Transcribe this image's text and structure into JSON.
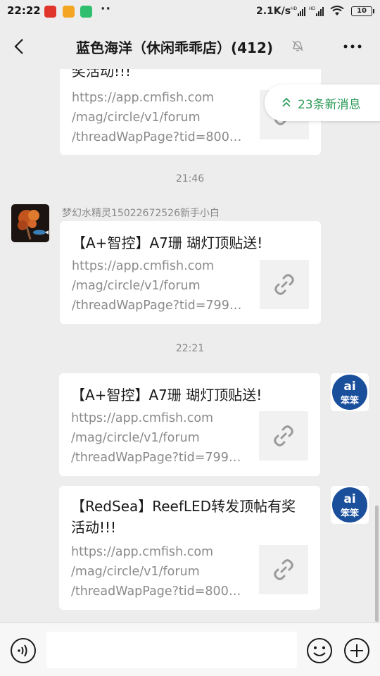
{
  "status_bar": {
    "time": "22:22",
    "network_speed": "2.1K/s",
    "signal_label": "HD",
    "more_notifications": "··",
    "battery": "10"
  },
  "header": {
    "title": "蓝色海洋（休闲乖乖店）(412)"
  },
  "new_messages": {
    "label": "23条新消息"
  },
  "messages": [
    {
      "title": "奖活动!!!",
      "url": "https://app.cmfish.com\n/mag/circle/v1/forum\n/threadWapPage?tid=800…"
    },
    {
      "time": "21:46",
      "sender": "梦幻水精灵15022672526新手小白",
      "title": "【A+智控】A7珊 瑚灯顶贴送!",
      "url": "https://app.cmfish.com\n/mag/circle/v1/forum\n/threadWapPage?tid=799…"
    },
    {
      "time": "22:21",
      "title": "【A+智控】A7珊 瑚灯顶贴送!",
      "url": "https://app.cmfish.com\n/mag/circle/v1/forum\n/threadWapPage?tid=799…"
    },
    {
      "title": "【RedSea】ReefLED转发顶帖有奖活动!!!",
      "url": "https://app.cmfish.com\n/mag/circle/v1/forum\n/threadWapPage?tid=800…"
    }
  ],
  "self_avatar_text": {
    "top": "ai",
    "bottom": "笨笨"
  },
  "colors": {
    "background": "#ededed",
    "bubble": "#ffffff",
    "new_message_green": "#2e9c5a",
    "avatar_blue": "#1a4f9c",
    "link_gray": "#8a8a8a"
  },
  "icons": {
    "back": "back-chevron-icon",
    "mute": "bell-muted-icon",
    "more": "more-dots-icon",
    "voice": "voice-icon",
    "emoji": "emoji-icon",
    "plus": "plus-icon",
    "link": "link-icon",
    "new_messages": "double-chevron-up-icon"
  }
}
